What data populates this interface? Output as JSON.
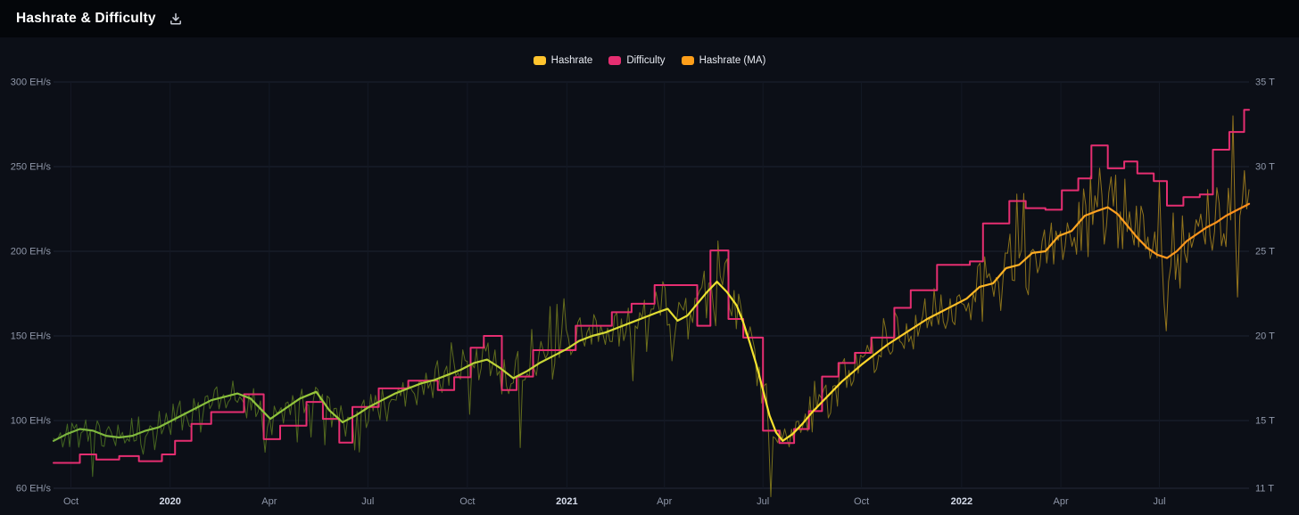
{
  "header": {
    "title": "Hashrate & Difficulty"
  },
  "legend": [
    {
      "id": "hashrate",
      "label": "Hashrate",
      "color": "#ffc42e"
    },
    {
      "id": "difficulty",
      "label": "Difficulty",
      "color": "#e62e71"
    },
    {
      "id": "hashrate-ma",
      "label": "Hashrate (MA)",
      "color": "#ff9f1a"
    }
  ],
  "colors": {
    "background": "#0c0f17",
    "header_background": "#04060a",
    "tick_label": "#8f97a9",
    "year_label": "#d6dcea",
    "title": "#ffffff"
  },
  "chart_data": {
    "type": "line",
    "title": "Hashrate & Difficulty",
    "x_unit": "months_since_2019-09-15",
    "x_domain": [
      0,
      36.4
    ],
    "legend_position": "top-center",
    "grid": {
      "horizontal": true,
      "vertical": true,
      "color_h": "#1d2330",
      "color_v": "#141925",
      "axis_color": "#232a3a"
    },
    "x_ticks": [
      {
        "x": 0.53,
        "label": "Oct"
      },
      {
        "x": 3.55,
        "label": "2020",
        "year": true
      },
      {
        "x": 6.57,
        "label": "Apr"
      },
      {
        "x": 9.57,
        "label": "Jul"
      },
      {
        "x": 12.6,
        "label": "Oct"
      },
      {
        "x": 15.63,
        "label": "2021",
        "year": true
      },
      {
        "x": 18.6,
        "label": "Apr"
      },
      {
        "x": 21.6,
        "label": "Jul"
      },
      {
        "x": 24.6,
        "label": "Oct"
      },
      {
        "x": 27.65,
        "label": "2022",
        "year": true
      },
      {
        "x": 30.67,
        "label": "Apr"
      },
      {
        "x": 33.67,
        "label": "Jul"
      }
    ],
    "y_left": {
      "unit": "EH/s",
      "domain": [
        60,
        300
      ],
      "ticks": [
        {
          "value": 300,
          "label": "300 EH/s"
        },
        {
          "value": 250,
          "label": "250 EH/s"
        },
        {
          "value": 200,
          "label": "200 EH/s"
        },
        {
          "value": 150,
          "label": "150 EH/s"
        },
        {
          "value": 100,
          "label": "100 EH/s"
        },
        {
          "value": 60,
          "label": "60 EH/s"
        }
      ]
    },
    "y_right": {
      "unit": "T",
      "domain": [
        11,
        35
      ],
      "ticks": [
        {
          "value": 35,
          "label": "35 T"
        },
        {
          "value": 30,
          "label": "30 T"
        },
        {
          "value": 25,
          "label": "25 T"
        },
        {
          "value": 20,
          "label": "20 T"
        },
        {
          "value": 15,
          "label": "15 T"
        },
        {
          "value": 11,
          "label": "11 T"
        }
      ]
    },
    "series": [
      {
        "id": "hashrate_raw",
        "name": "Hashrate",
        "axis": "left",
        "style": "noisy",
        "width": 1,
        "opacity": 0.8,
        "derived_from": "hashrate_ma",
        "gradient": [
          [
            0,
            "#4e7a23"
          ],
          [
            0.3,
            "#6a7f1e"
          ],
          [
            0.5,
            "#86871c"
          ],
          [
            0.7,
            "#9d861a"
          ],
          [
            0.85,
            "#ad8a1b"
          ],
          [
            1,
            "#b88f1e"
          ]
        ],
        "noise": {
          "seed": 11,
          "interval": 0.07,
          "rel_std": 0.055,
          "clamp": 0.22,
          "spike_chance": 0.07,
          "spike_scale": 2.6
        },
        "anomalies": [
          [
            1.2,
            67
          ],
          [
            14.2,
            84
          ],
          [
            21.85,
            55
          ],
          [
            35.9,
            280
          ],
          [
            36.05,
            173
          ]
        ]
      },
      {
        "id": "difficulty",
        "name": "Difficulty",
        "axis": "right",
        "style": "step",
        "color": "#e62e71",
        "width": 2,
        "points": [
          [
            0,
            12.5
          ],
          [
            0.8,
            13.0
          ],
          [
            1.3,
            12.7
          ],
          [
            2.0,
            12.9
          ],
          [
            2.6,
            12.6
          ],
          [
            3.3,
            13.0
          ],
          [
            3.7,
            13.8
          ],
          [
            4.2,
            14.8
          ],
          [
            4.8,
            15.5
          ],
          [
            5.8,
            16.55
          ],
          [
            6.4,
            13.9
          ],
          [
            6.9,
            14.7
          ],
          [
            7.7,
            16.1
          ],
          [
            8.2,
            15.1
          ],
          [
            8.7,
            13.7
          ],
          [
            9.1,
            15.8
          ],
          [
            9.9,
            16.9
          ],
          [
            10.8,
            17.35
          ],
          [
            11.7,
            16.8
          ],
          [
            12.2,
            17.56
          ],
          [
            12.7,
            19.3
          ],
          [
            13.1,
            20.0
          ],
          [
            13.65,
            16.8
          ],
          [
            14.1,
            17.6
          ],
          [
            14.6,
            19.16
          ],
          [
            15.9,
            20.6
          ],
          [
            17.0,
            21.4
          ],
          [
            17.6,
            21.9
          ],
          [
            18.3,
            23.0
          ],
          [
            19.6,
            20.6
          ],
          [
            20.0,
            25.05
          ],
          [
            20.55,
            21.0
          ],
          [
            21.0,
            19.9
          ],
          [
            21.6,
            14.4
          ],
          [
            22.1,
            13.67
          ],
          [
            22.55,
            14.5
          ],
          [
            23.0,
            15.56
          ],
          [
            23.4,
            17.6
          ],
          [
            23.9,
            18.4
          ],
          [
            24.4,
            19.0
          ],
          [
            24.9,
            19.9
          ],
          [
            25.6,
            21.66
          ],
          [
            26.1,
            22.7
          ],
          [
            26.9,
            24.2
          ],
          [
            27.9,
            24.4
          ],
          [
            28.3,
            26.64
          ],
          [
            29.1,
            27.97
          ],
          [
            29.6,
            27.55
          ],
          [
            30.2,
            27.45
          ],
          [
            30.7,
            28.6
          ],
          [
            31.2,
            29.3
          ],
          [
            31.6,
            31.25
          ],
          [
            32.1,
            29.9
          ],
          [
            32.6,
            30.3
          ],
          [
            33.0,
            29.6
          ],
          [
            33.5,
            29.15
          ],
          [
            33.9,
            27.7
          ],
          [
            34.4,
            28.2
          ],
          [
            34.9,
            28.35
          ],
          [
            35.3,
            31.0
          ],
          [
            35.8,
            32.05
          ],
          [
            36.25,
            33.35
          ],
          [
            36.4,
            33.35
          ]
        ]
      },
      {
        "id": "hashrate_ma",
        "name": "Hashrate (MA)",
        "axis": "left",
        "style": "line",
        "width": 2.2,
        "gradient": [
          [
            0,
            "#7ab33f"
          ],
          [
            0.18,
            "#8ec43c"
          ],
          [
            0.34,
            "#b5cf38"
          ],
          [
            0.48,
            "#dcdc34"
          ],
          [
            0.58,
            "#f4e42f"
          ],
          [
            0.68,
            "#ffd62b"
          ],
          [
            0.78,
            "#ffb525"
          ],
          [
            0.88,
            "#ffa01f"
          ],
          [
            1,
            "#ff8e1b"
          ]
        ],
        "points": [
          [
            0,
            88
          ],
          [
            0.4,
            92
          ],
          [
            0.8,
            95
          ],
          [
            1.2,
            94
          ],
          [
            1.6,
            91
          ],
          [
            2,
            90
          ],
          [
            2.4,
            91
          ],
          [
            2.8,
            94
          ],
          [
            3.2,
            96
          ],
          [
            3.6,
            100
          ],
          [
            4,
            104
          ],
          [
            4.4,
            108
          ],
          [
            4.8,
            112
          ],
          [
            5.2,
            114
          ],
          [
            5.6,
            116
          ],
          [
            6,
            113
          ],
          [
            6.3,
            107
          ],
          [
            6.6,
            101
          ],
          [
            6.9,
            105
          ],
          [
            7.2,
            109
          ],
          [
            7.5,
            113
          ],
          [
            8,
            117
          ],
          [
            8.4,
            106
          ],
          [
            8.8,
            99
          ],
          [
            9.2,
            103
          ],
          [
            9.6,
            108
          ],
          [
            10,
            112
          ],
          [
            10.4,
            116
          ],
          [
            10.8,
            119
          ],
          [
            11.2,
            122
          ],
          [
            11.6,
            124
          ],
          [
            12,
            127
          ],
          [
            12.4,
            130
          ],
          [
            12.8,
            134
          ],
          [
            13.2,
            136
          ],
          [
            13.6,
            131
          ],
          [
            14,
            125
          ],
          [
            14.4,
            129
          ],
          [
            14.8,
            134
          ],
          [
            15.2,
            138
          ],
          [
            15.6,
            142
          ],
          [
            16,
            147
          ],
          [
            16.4,
            150
          ],
          [
            16.8,
            152
          ],
          [
            17.2,
            155
          ],
          [
            17.6,
            158
          ],
          [
            18,
            161
          ],
          [
            18.4,
            164
          ],
          [
            18.7,
            166
          ],
          [
            19,
            159
          ],
          [
            19.3,
            162
          ],
          [
            19.6,
            169
          ],
          [
            19.9,
            176
          ],
          [
            20.2,
            182
          ],
          [
            20.5,
            176
          ],
          [
            20.8,
            168
          ],
          [
            21,
            158
          ],
          [
            21.2,
            146
          ],
          [
            21.4,
            133
          ],
          [
            21.6,
            118
          ],
          [
            21.8,
            103
          ],
          [
            22,
            93
          ],
          [
            22.2,
            88
          ],
          [
            22.5,
            92
          ],
          [
            22.8,
            98
          ],
          [
            23.1,
            105
          ],
          [
            23.4,
            111
          ],
          [
            23.7,
            117
          ],
          [
            24,
            123
          ],
          [
            24.3,
            128
          ],
          [
            24.6,
            133
          ],
          [
            25,
            139
          ],
          [
            25.4,
            145
          ],
          [
            25.8,
            150
          ],
          [
            26.2,
            155
          ],
          [
            26.6,
            160
          ],
          [
            27,
            164
          ],
          [
            27.4,
            168
          ],
          [
            27.8,
            172
          ],
          [
            28.2,
            179
          ],
          [
            28.6,
            181
          ],
          [
            29,
            190
          ],
          [
            29.4,
            192
          ],
          [
            29.8,
            199
          ],
          [
            30.2,
            200
          ],
          [
            30.6,
            209
          ],
          [
            31,
            212
          ],
          [
            31.4,
            221
          ],
          [
            31.8,
            224
          ],
          [
            32.1,
            226
          ],
          [
            32.4,
            222
          ],
          [
            32.7,
            215
          ],
          [
            33,
            208
          ],
          [
            33.3,
            202
          ],
          [
            33.6,
            198
          ],
          [
            33.9,
            196
          ],
          [
            34.2,
            200
          ],
          [
            34.5,
            206
          ],
          [
            34.8,
            210
          ],
          [
            35.1,
            214
          ],
          [
            35.4,
            217
          ],
          [
            35.7,
            221
          ],
          [
            36,
            224
          ],
          [
            36.2,
            226
          ],
          [
            36.4,
            228
          ]
        ]
      }
    ]
  }
}
